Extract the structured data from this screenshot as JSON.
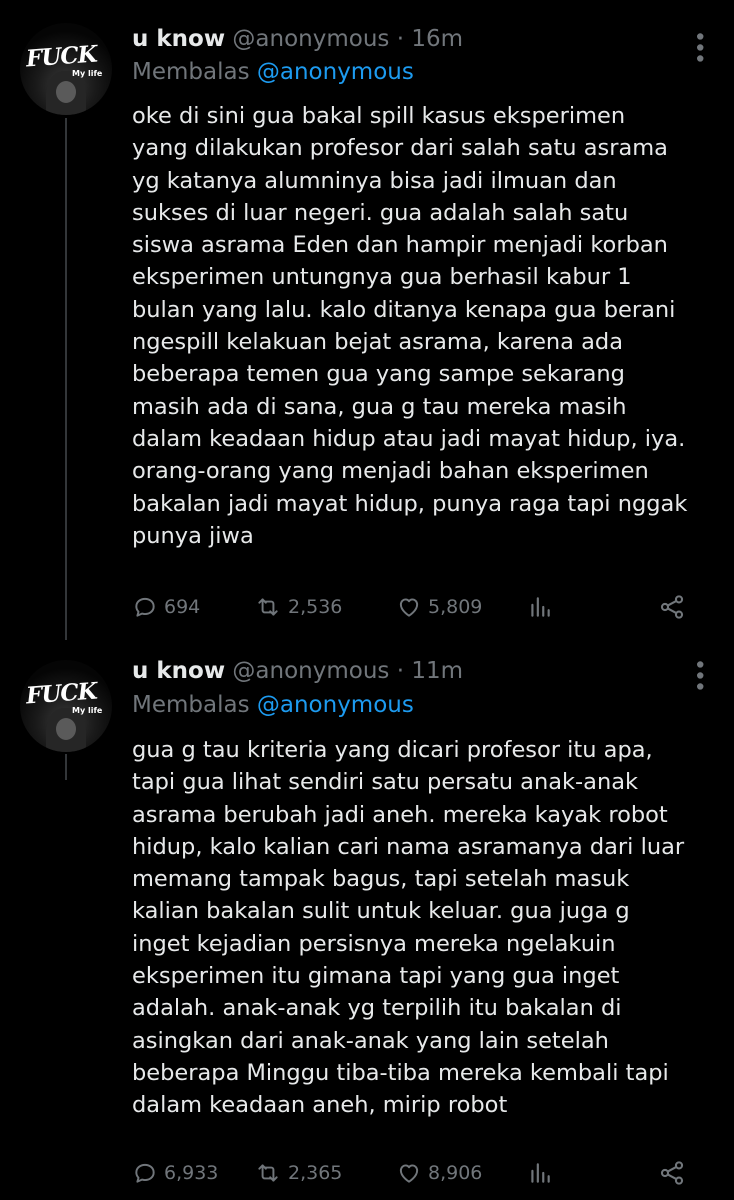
{
  "tweets": [
    {
      "avatar": {
        "logo_text": "FUCK",
        "tagline": "My life"
      },
      "display_name": "u know",
      "handle": "@anonymous",
      "separator": "·",
      "time": "16m",
      "reply_prefix": "Membalas",
      "reply_mention": "@anonymous",
      "text": "oke di sini gua bakal spill kasus eksperimen\nyang dilakukan profesor dari salah satu asrama\nyg katanya alumninya bisa jadi ilmuan dan\nsukses  di luar negeri. gua adalah salah satu\nsiswa  asrama Eden dan hampir menjadi korban\neksperimen untungnya gua berhasil kabur 1\nbulan yang lalu. kalo ditanya kenapa gua berani\nngespill kelakuan bejat asrama, karena ada\nbeberapa temen gua yang sampe sekarang\nmasih ada di sana, gua g tau mereka masih\ndalam keadaan hidup atau jadi mayat hidup, iya.\norang-orang yang menjadi bahan eksperimen\nbakalan jadi mayat hidup, punya raga tapi nggak\npunya jiwa",
      "replies": "694",
      "retweets": "2,536",
      "likes": "5,809"
    },
    {
      "avatar": {
        "logo_text": "FUCK",
        "tagline": "My life"
      },
      "display_name": "u know",
      "handle": "@anonymous",
      "separator": "·",
      "time": "11m",
      "reply_prefix": "Membalas",
      "reply_mention": "@anonymous",
      "text": "gua g tau kriteria yang dicari profesor itu apa,\ntapi gua lihat sendiri satu persatu anak-anak\nasrama berubah jadi aneh. mereka kayak robot\nhidup, kalo kalian cari nama asramanya dari luar\nmemang tampak bagus, tapi setelah masuk\nkalian bakalan sulit untuk keluar. gua juga g\ninget kejadian persisnya mereka ngelakuin\neksperimen itu gimana tapi yang gua inget\nadalah. anak-anak yg terpilih itu bakalan di\nasingkan dari anak-anak yang lain setelah\nbeberapa Minggu tiba-tiba mereka kembali tapi\ndalam keadaan aneh, mirip robot",
      "replies": "6,933",
      "retweets": "2,365",
      "likes": "8,906"
    }
  ],
  "icons": {
    "reply": "reply-icon",
    "retweet": "retweet-icon",
    "like": "heart-icon",
    "views": "analytics-icon",
    "share": "share-icon",
    "more": "more-options-icon"
  },
  "colors": {
    "background": "#000000",
    "text_primary": "#e7e9ea",
    "text_secondary": "#71767b",
    "link": "#1d9bf0",
    "thread_line": "#333639"
  }
}
